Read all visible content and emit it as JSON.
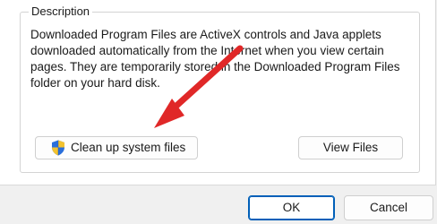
{
  "group": {
    "title": "Description"
  },
  "description": {
    "text": "Downloaded Program Files are ActiveX controls and Java applets\ndownloaded automatically from the Internet when you view certain\npages. They are temporarily stored in the Downloaded Program Files\nfolder on your hard disk."
  },
  "buttons": {
    "cleanup": "Clean up system files",
    "view_files": "View Files",
    "ok": "OK",
    "cancel": "Cancel"
  },
  "icons": {
    "cleanup": "shield-icon",
    "annotation": "red-arrow-icon"
  },
  "colors": {
    "arrow": "#e02828",
    "primary_border": "#005fb8"
  }
}
